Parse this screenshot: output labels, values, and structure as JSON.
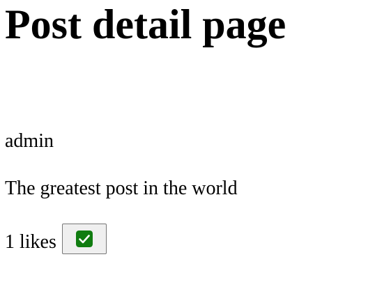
{
  "page": {
    "title": "Post detail page"
  },
  "post": {
    "author": "admin",
    "body": "The greatest post in the world",
    "likes_count": "1",
    "likes_label": "likes"
  },
  "like_button": {
    "icon": "check-icon",
    "checked": true,
    "icon_color": "#107c10",
    "button_background": "#efefef"
  }
}
